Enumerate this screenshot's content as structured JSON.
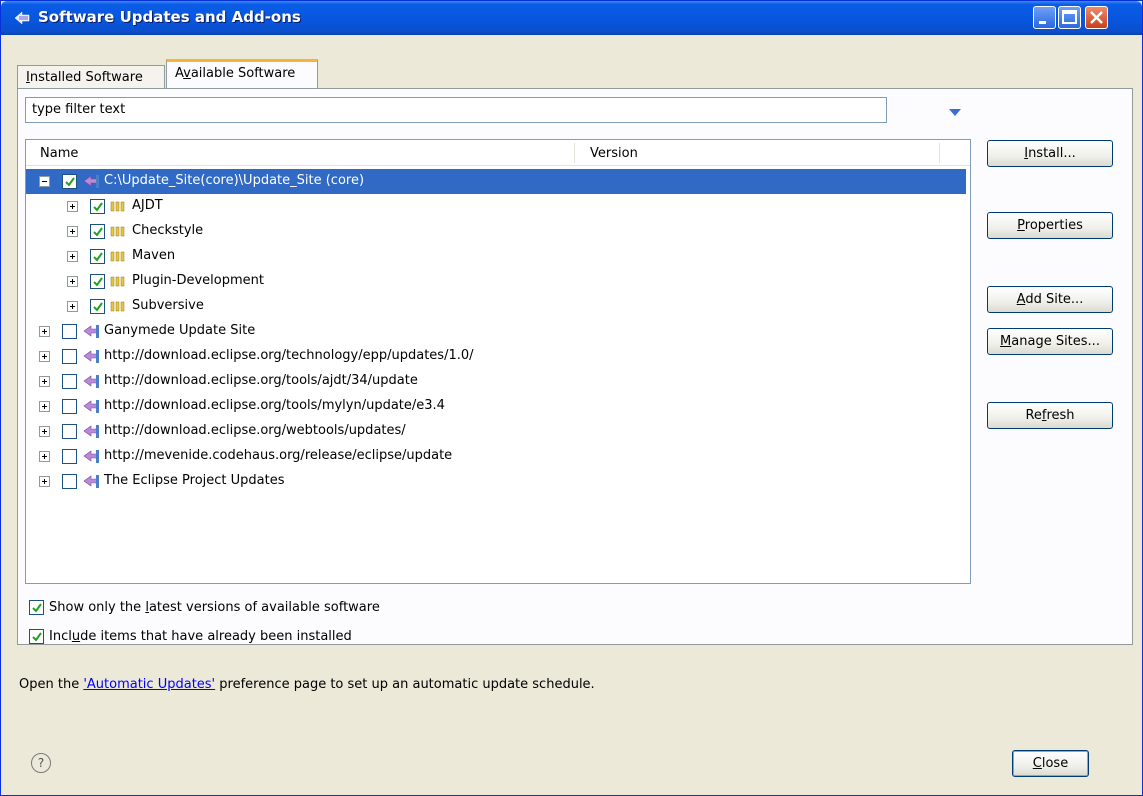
{
  "window": {
    "title": "Software Updates and Add-ons"
  },
  "tabs": [
    {
      "label": "Installed Software",
      "mnemonic": "I",
      "rest": "nstalled Software",
      "active": false
    },
    {
      "label": "Available Software",
      "pre": "A",
      "mnemonic": "v",
      "rest": "ailable Software",
      "active": true
    }
  ],
  "filter": {
    "value": "type filter text"
  },
  "tree": {
    "columns": {
      "name": "Name",
      "version": "Version"
    },
    "rows": [
      {
        "label": "C:\\Update_Site(core)\\Update_Site (core)",
        "checked": true,
        "level": 0,
        "expanded": true,
        "selected": true,
        "icon": "update-site-icon"
      },
      {
        "label": "AJDT",
        "checked": true,
        "level": 1,
        "icon": "category-icon"
      },
      {
        "label": "Checkstyle",
        "checked": true,
        "level": 1,
        "icon": "category-icon"
      },
      {
        "label": "Maven",
        "checked": true,
        "level": 1,
        "icon": "category-icon"
      },
      {
        "label": "Plugin-Development",
        "checked": true,
        "level": 1,
        "icon": "category-icon"
      },
      {
        "label": "Subversive",
        "checked": true,
        "level": 1,
        "icon": "category-icon"
      },
      {
        "label": "Ganymede Update Site",
        "checked": false,
        "level": 0,
        "icon": "update-site-icon"
      },
      {
        "label": "http://download.eclipse.org/technology/epp/updates/1.0/",
        "checked": false,
        "level": 0,
        "icon": "update-site-icon"
      },
      {
        "label": "http://download.eclipse.org/tools/ajdt/34/update",
        "checked": false,
        "level": 0,
        "icon": "update-site-icon"
      },
      {
        "label": "http://download.eclipse.org/tools/mylyn/update/e3.4",
        "checked": false,
        "level": 0,
        "icon": "update-site-icon"
      },
      {
        "label": "http://download.eclipse.org/webtools/updates/",
        "checked": false,
        "level": 0,
        "icon": "update-site-icon"
      },
      {
        "label": "http://mevenide.codehaus.org/release/eclipse/update",
        "checked": false,
        "level": 0,
        "icon": "update-site-icon"
      },
      {
        "label": "The Eclipse Project Updates",
        "checked": false,
        "level": 0,
        "icon": "update-site-icon"
      }
    ]
  },
  "buttons": {
    "install": {
      "mnemonic": "I",
      "rest": "nstall..."
    },
    "properties": {
      "mnemonic": "P",
      "rest": "roperties"
    },
    "add_site": {
      "mnemonic": "A",
      "rest": "dd Site..."
    },
    "manage_sites": {
      "mnemonic": "M",
      "rest": "anage Sites..."
    },
    "refresh": {
      "pre": "Re",
      "mnemonic": "f",
      "rest": "resh"
    },
    "close": {
      "mnemonic": "C",
      "rest": "lose"
    }
  },
  "options": {
    "latest": {
      "pre": "Show only the ",
      "mnemonic": "l",
      "rest": "atest versions of available software",
      "checked": true
    },
    "installed": {
      "pre": "Incl",
      "mnemonic": "u",
      "rest": "de items that have already been installed",
      "checked": true
    }
  },
  "info": {
    "pre": "Open the ",
    "link": "'Automatic Updates'",
    "post": " preference page to set up an automatic update schedule."
  },
  "help": {
    "glyph": "?"
  }
}
